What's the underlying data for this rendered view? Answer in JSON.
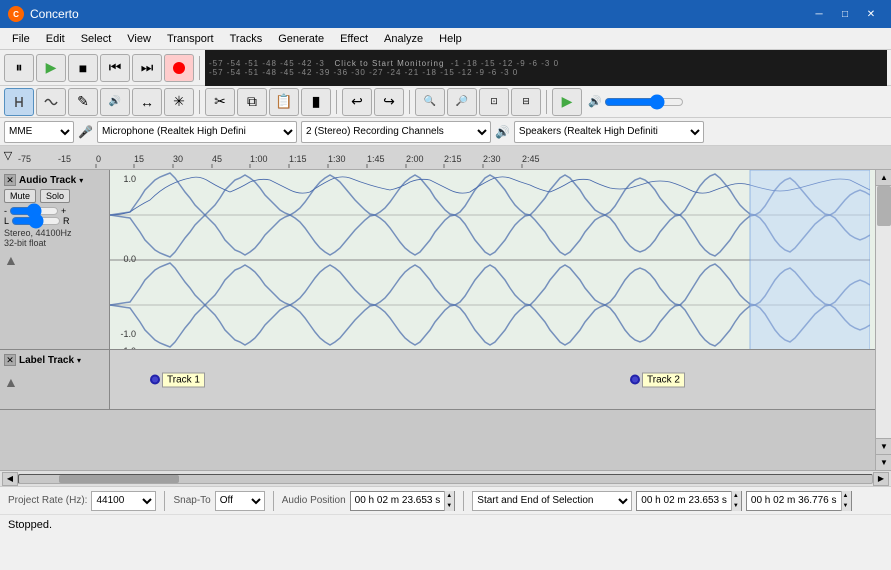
{
  "app": {
    "title": "Concerto",
    "icon_char": "C"
  },
  "window_controls": {
    "minimize": "─",
    "maximize": "□",
    "close": "✕"
  },
  "menu": {
    "items": [
      "File",
      "Edit",
      "Select",
      "View",
      "Transport",
      "Tracks",
      "Generate",
      "Effect",
      "Analyze",
      "Help"
    ]
  },
  "toolbar1": {
    "pause_label": "⏸",
    "play_label": "▶",
    "stop_label": "■",
    "prev_label": "⏮",
    "next_label": "⏭",
    "record_label": "●",
    "vu_scale1": "-57  -54  -51  -48  -45  -42  -3",
    "vu_click": "Click to Start Monitoring",
    "vu_scale2": "-57  -54  -51  -48  -45  -42  -39  -36  -30  -27  -24  -21  -18  -15  -12  -9  -6  -3  0"
  },
  "toolbar2": {
    "tools": [
      "↖",
      "↔",
      "✎",
      "🔊",
      "✕",
      "↗"
    ],
    "zoom_in": "🔍+",
    "zoom_out": "🔍-",
    "zoom_tools": [
      "⬚",
      "🔍",
      "🔍"
    ]
  },
  "timeline": {
    "marks": [
      "-75",
      "-15",
      "0",
      "15",
      "30",
      "45",
      "1:00",
      "1:15",
      "1:30",
      "1:45",
      "2:00",
      "2:15",
      "2:30",
      "2:45"
    ]
  },
  "audio_track": {
    "name": "Audio Track",
    "mute_label": "Mute",
    "solo_label": "Solo",
    "info": "Stereo, 44100Hz\n32-bit float"
  },
  "label_track": {
    "name": "Label Track",
    "label1": "Track 1",
    "label2": "Track 2"
  },
  "bottom": {
    "project_rate_label": "Project Rate (Hz):",
    "project_rate_value": "44100",
    "snap_to_label": "Snap-To",
    "snap_to_value": "Off",
    "audio_position_label": "Audio Position",
    "selection_label": "Start and End of Selection",
    "time1": "00 h 02 m 23.653 s",
    "time2": "00 h 02 m 23.653 s",
    "time3": "00 h 02 m 36.776 s"
  },
  "device": {
    "api": "MME",
    "mic": "Microphone (Realtek High Defini",
    "channels": "2 (Stereo) Recording Channels",
    "speaker": "Speakers (Realtek High Definiti"
  },
  "status": {
    "text": "Stopped."
  }
}
